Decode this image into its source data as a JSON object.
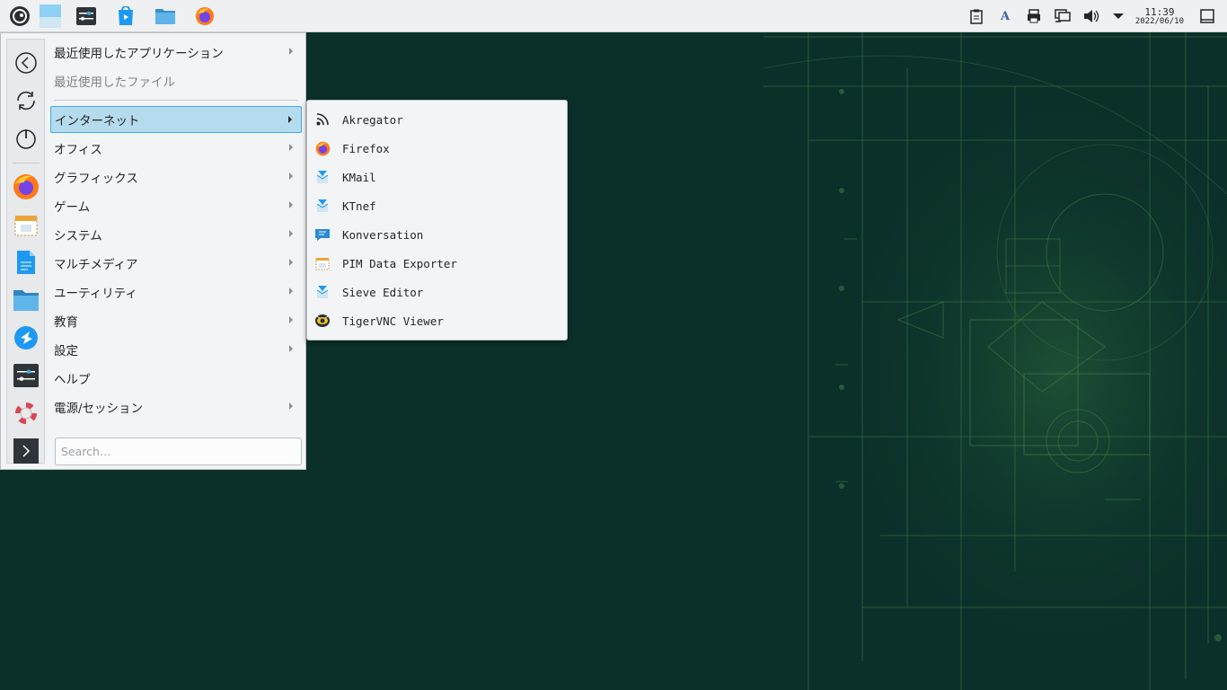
{
  "taskbar": {
    "launchers": [
      {
        "icon": "opensuse-launcher-icon"
      },
      {
        "icon": "desktop-pager-icon"
      },
      {
        "icon": "system-settings-icon"
      },
      {
        "icon": "discover-store-icon"
      },
      {
        "icon": "file-manager-icon"
      },
      {
        "icon": "firefox-icon"
      }
    ],
    "tray": [
      {
        "icon": "clipboard-icon"
      },
      {
        "icon": "input-method-icon",
        "text": "A"
      },
      {
        "icon": "printer-icon"
      },
      {
        "icon": "network-icon"
      },
      {
        "icon": "volume-icon"
      },
      {
        "icon": "tray-expand-icon"
      }
    ],
    "clock": {
      "time": "11:39",
      "date": "2022/06/10"
    },
    "show_desktop_icon": "show-desktop-icon"
  },
  "menu": {
    "favorites": [
      "back-icon",
      "refresh-icon",
      "power-icon",
      "firefox-icon",
      "pim-icon",
      "document-writer-icon",
      "folder-icon",
      "kde-connect-icon",
      "terminal-settings-icon",
      "help-lifebuoy-icon",
      "konsole-icon"
    ],
    "categories": [
      {
        "label": "最近使用したアプリケーション",
        "has_submenu": true
      },
      {
        "label": "最近使用したファイル",
        "has_submenu": false,
        "disabled": true
      },
      {
        "label": "インターネット",
        "has_submenu": true,
        "active": true
      },
      {
        "label": "オフィス",
        "has_submenu": true
      },
      {
        "label": "グラフィックス",
        "has_submenu": true
      },
      {
        "label": "ゲーム",
        "has_submenu": true
      },
      {
        "label": "システム",
        "has_submenu": true
      },
      {
        "label": "マルチメディア",
        "has_submenu": true
      },
      {
        "label": "ユーティリティ",
        "has_submenu": true
      },
      {
        "label": "教育",
        "has_submenu": true
      },
      {
        "label": "設定",
        "has_submenu": true
      },
      {
        "label": "ヘルプ",
        "has_submenu": false
      },
      {
        "label": "電源/セッション",
        "has_submenu": true
      }
    ],
    "search": {
      "placeholder": "Search…",
      "value": ""
    }
  },
  "submenu": {
    "items": [
      {
        "label": "Akregator",
        "icon": "rss-feed-icon"
      },
      {
        "label": "Firefox",
        "icon": "firefox-icon"
      },
      {
        "label": "KMail",
        "icon": "kmail-icon"
      },
      {
        "label": "KTnef",
        "icon": "ktnef-icon"
      },
      {
        "label": "Konversation",
        "icon": "konversation-icon"
      },
      {
        "label": "PIM Data Exporter",
        "icon": "pim-data-exporter-icon"
      },
      {
        "label": "Sieve Editor",
        "icon": "sieve-editor-icon"
      },
      {
        "label": "TigerVNC Viewer",
        "icon": "tigervnc-icon"
      }
    ]
  },
  "colors": {
    "wallpaper": "#0b302a",
    "panel": "#eef0f1",
    "highlight": "#b4dbee",
    "highlight_border": "#3daee9"
  }
}
